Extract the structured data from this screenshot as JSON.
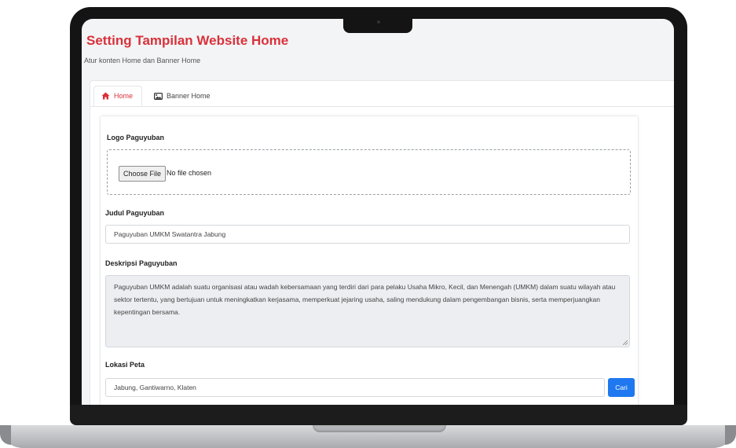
{
  "page": {
    "title": "Setting Tampilan Website Home",
    "subtitle": "Atur konten Home dan Banner Home"
  },
  "tabs": [
    {
      "label": "Home",
      "icon": "home-icon",
      "active": true
    },
    {
      "label": "Banner Home",
      "icon": "image-icon",
      "active": false
    }
  ],
  "form": {
    "logo": {
      "label": "Logo Paguyuban",
      "button_label": "Choose File",
      "status": "No file chosen"
    },
    "judul": {
      "label": "Judul Paguyuban",
      "value": "Paguyuban UMKM Swatantra Jabung"
    },
    "deskripsi": {
      "label": "Deskripsi Paguyuban",
      "value": "Paguyuban UMKM adalah suatu organisasi atau wadah kebersamaan yang terdiri dari para pelaku Usaha Mikro, Kecil, dan Menengah (UMKM) dalam suatu wilayah atau sektor tertentu, yang bertujuan untuk meningkatkan kerjasama, memperkuat jejaring usaha, saling mendukung dalam pengembangan bisnis, serta memperjuangkan kepentingan bersama."
    },
    "lokasi": {
      "label": "Lokasi Peta",
      "value": "Jabung, Gantiwarno, Klaten",
      "button_label": "Cari"
    }
  },
  "colors": {
    "accent": "#d9313b",
    "primary_button": "#1f78f0"
  }
}
